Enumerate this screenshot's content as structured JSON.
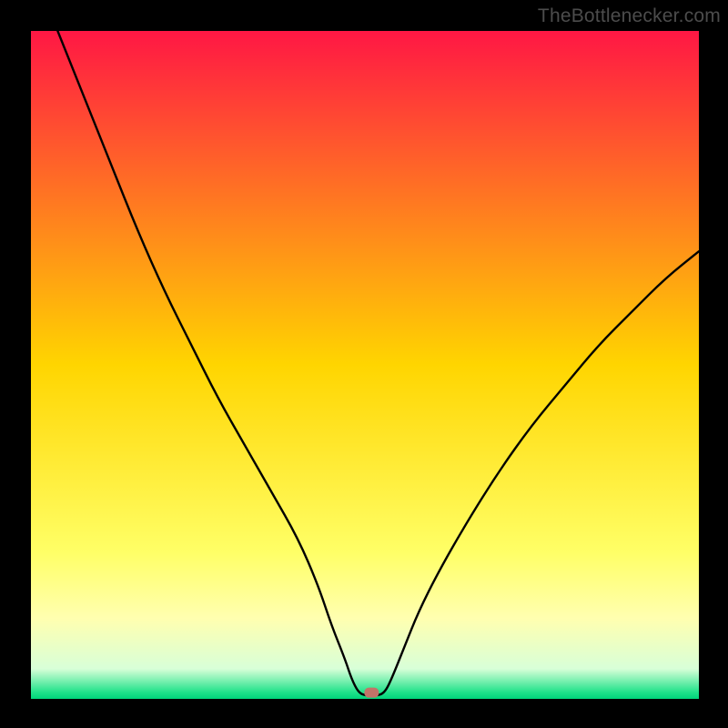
{
  "watermark": "TheBottlenecker.com",
  "chart_data": {
    "type": "line",
    "title": "",
    "xlabel": "",
    "ylabel": "",
    "xlim": [
      0,
      100
    ],
    "ylim": [
      0,
      100
    ],
    "marker": {
      "x": 51,
      "y": 1,
      "color": "#c37368"
    },
    "gradient_stops": [
      {
        "offset": 0,
        "color": "#ff1744"
      },
      {
        "offset": 0.5,
        "color": "#ffd500"
      },
      {
        "offset": 0.78,
        "color": "#ffff66"
      },
      {
        "offset": 0.88,
        "color": "#ffffb0"
      },
      {
        "offset": 0.955,
        "color": "#d8ffd8"
      },
      {
        "offset": 0.99,
        "color": "#20e28a"
      },
      {
        "offset": 1.0,
        "color": "#00d47a"
      }
    ],
    "series": [
      {
        "name": "curve",
        "points": [
          {
            "x": 4,
            "y": 100
          },
          {
            "x": 8,
            "y": 90
          },
          {
            "x": 12,
            "y": 80
          },
          {
            "x": 16,
            "y": 70
          },
          {
            "x": 20,
            "y": 61
          },
          {
            "x": 24,
            "y": 53
          },
          {
            "x": 28,
            "y": 45
          },
          {
            "x": 32,
            "y": 38
          },
          {
            "x": 36,
            "y": 31
          },
          {
            "x": 40,
            "y": 24
          },
          {
            "x": 43,
            "y": 17
          },
          {
            "x": 45,
            "y": 11
          },
          {
            "x": 47,
            "y": 6
          },
          {
            "x": 48,
            "y": 3
          },
          {
            "x": 49,
            "y": 1
          },
          {
            "x": 50,
            "y": 0.5
          },
          {
            "x": 52,
            "y": 0.5
          },
          {
            "x": 53,
            "y": 1
          },
          {
            "x": 54,
            "y": 3
          },
          {
            "x": 56,
            "y": 8
          },
          {
            "x": 58,
            "y": 13
          },
          {
            "x": 61,
            "y": 19
          },
          {
            "x": 65,
            "y": 26
          },
          {
            "x": 70,
            "y": 34
          },
          {
            "x": 75,
            "y": 41
          },
          {
            "x": 80,
            "y": 47
          },
          {
            "x": 85,
            "y": 53
          },
          {
            "x": 90,
            "y": 58
          },
          {
            "x": 95,
            "y": 63
          },
          {
            "x": 100,
            "y": 67
          }
        ]
      }
    ]
  }
}
